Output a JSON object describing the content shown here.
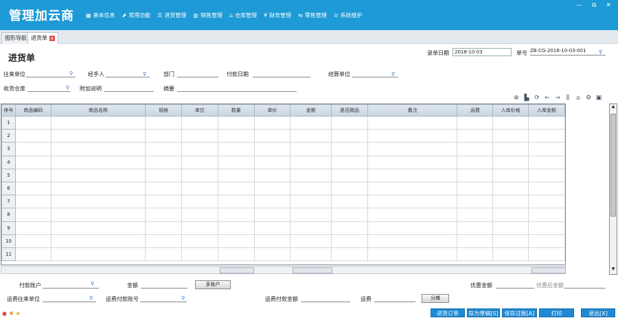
{
  "app": {
    "title": "管理加云商",
    "menu": [
      {
        "label": "基本信息",
        "icon": "grid-icon",
        "glyph": "▦"
      },
      {
        "label": "常用功能",
        "icon": "external-icon",
        "glyph": "⬈"
      },
      {
        "label": "进货管理",
        "icon": "list-icon",
        "glyph": "☰"
      },
      {
        "label": "销售管理",
        "icon": "chart-icon",
        "glyph": "▥"
      },
      {
        "label": "仓库管理",
        "icon": "home-icon",
        "glyph": "⌂"
      },
      {
        "label": "财务管理",
        "icon": "yen-icon",
        "glyph": "¥"
      },
      {
        "label": "零售管理",
        "icon": "exchange-icon",
        "glyph": "⇆"
      },
      {
        "label": "系统维护",
        "icon": "settings-icon",
        "glyph": "⊙"
      }
    ],
    "win": [
      "—",
      "⧉",
      "✕"
    ]
  },
  "tabs": [
    {
      "label": "图形导航"
    },
    {
      "label": "进货单",
      "close": "x"
    }
  ],
  "form": {
    "title": "进货单",
    "date_label": "录单日期",
    "date": "2018-10-03",
    "no_label": "单号",
    "no": "ZB-CG-2018-10-03-001",
    "row1": [
      "往来单位",
      "经手人",
      "部门",
      "付款日期",
      "结算单位"
    ],
    "row2": [
      "收货仓库",
      "附加说明",
      "摘要"
    ]
  },
  "grid": {
    "headers": [
      "序号",
      "商品编码",
      "商品名称",
      "规格",
      "单位",
      "数量",
      "单价",
      "金额",
      "是否赠品",
      "备注",
      "运费",
      "入库价格",
      "入库金额"
    ],
    "rows": [
      "1",
      "2",
      "3",
      "4",
      "5",
      "6",
      "7",
      "8",
      "9",
      "10",
      "11"
    ]
  },
  "bottom": {
    "pay_account": "付款账户",
    "amount": "金额",
    "multi_account": "多账户",
    "discount": "优惠金额",
    "after_discount": "优惠后金额",
    "freight_unit": "运费往来单位",
    "freight_account": "运费付款账号",
    "freight_paid": "运费付款金额",
    "freight": "运费",
    "split": "分摊"
  },
  "actions": [
    "进货订单",
    "存为草稿[S]",
    "保存过账[A]",
    "打印",
    "退出[X]"
  ]
}
